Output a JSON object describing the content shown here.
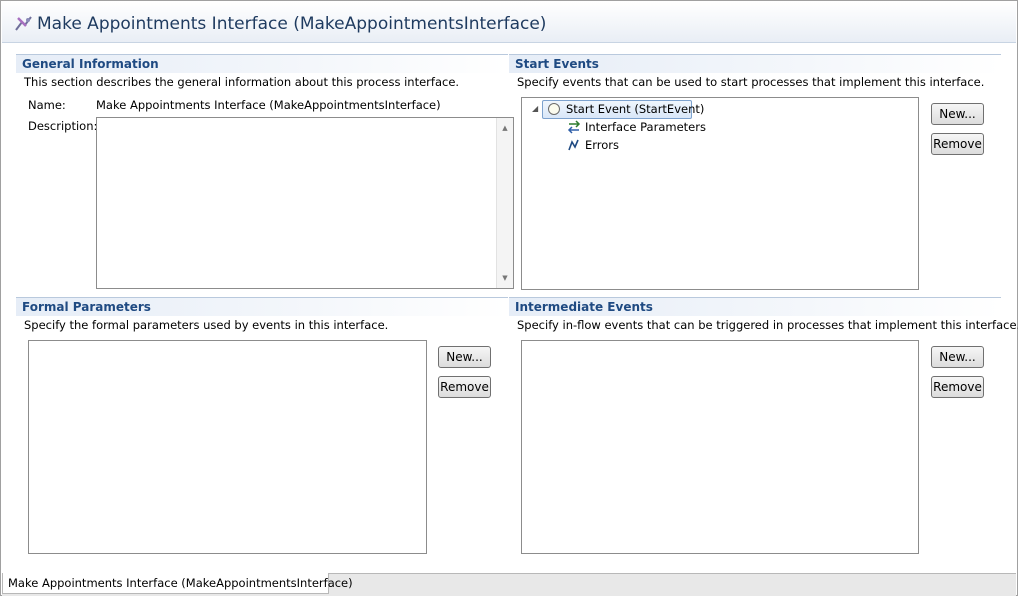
{
  "editor": {
    "title": "Make Appointments Interface (MakeAppointmentsInterface)",
    "title_icon": "process-interface-icon"
  },
  "general": {
    "title": "General Information",
    "description": "This section describes the general information about this process interface.",
    "name_label": "Name:",
    "name_value": "Make Appointments Interface (MakeAppointmentsInterface)",
    "description_label": "Description:",
    "description_value": ""
  },
  "start_events": {
    "title": "Start Events",
    "description": "Specify events that can be used to start processes that implement this interface.",
    "tree": {
      "root": "Start Event (StartEvent)",
      "children": [
        "Interface Parameters",
        "Errors"
      ]
    },
    "new_label": "New...",
    "remove_label": "Remove"
  },
  "formal_parameters": {
    "title": "Formal Parameters",
    "description": "Specify the formal parameters used by events in this interface.",
    "new_label": "New...",
    "remove_label": "Remove"
  },
  "intermediate_events": {
    "title": "Intermediate Events",
    "description": "Specify in-flow events that can be triggered in processes that implement this interface.",
    "new_label": "New...",
    "remove_label": "Remove"
  },
  "bottom_tab": {
    "label": "Make Appointments Interface (MakeAppointmentsInterface)"
  }
}
